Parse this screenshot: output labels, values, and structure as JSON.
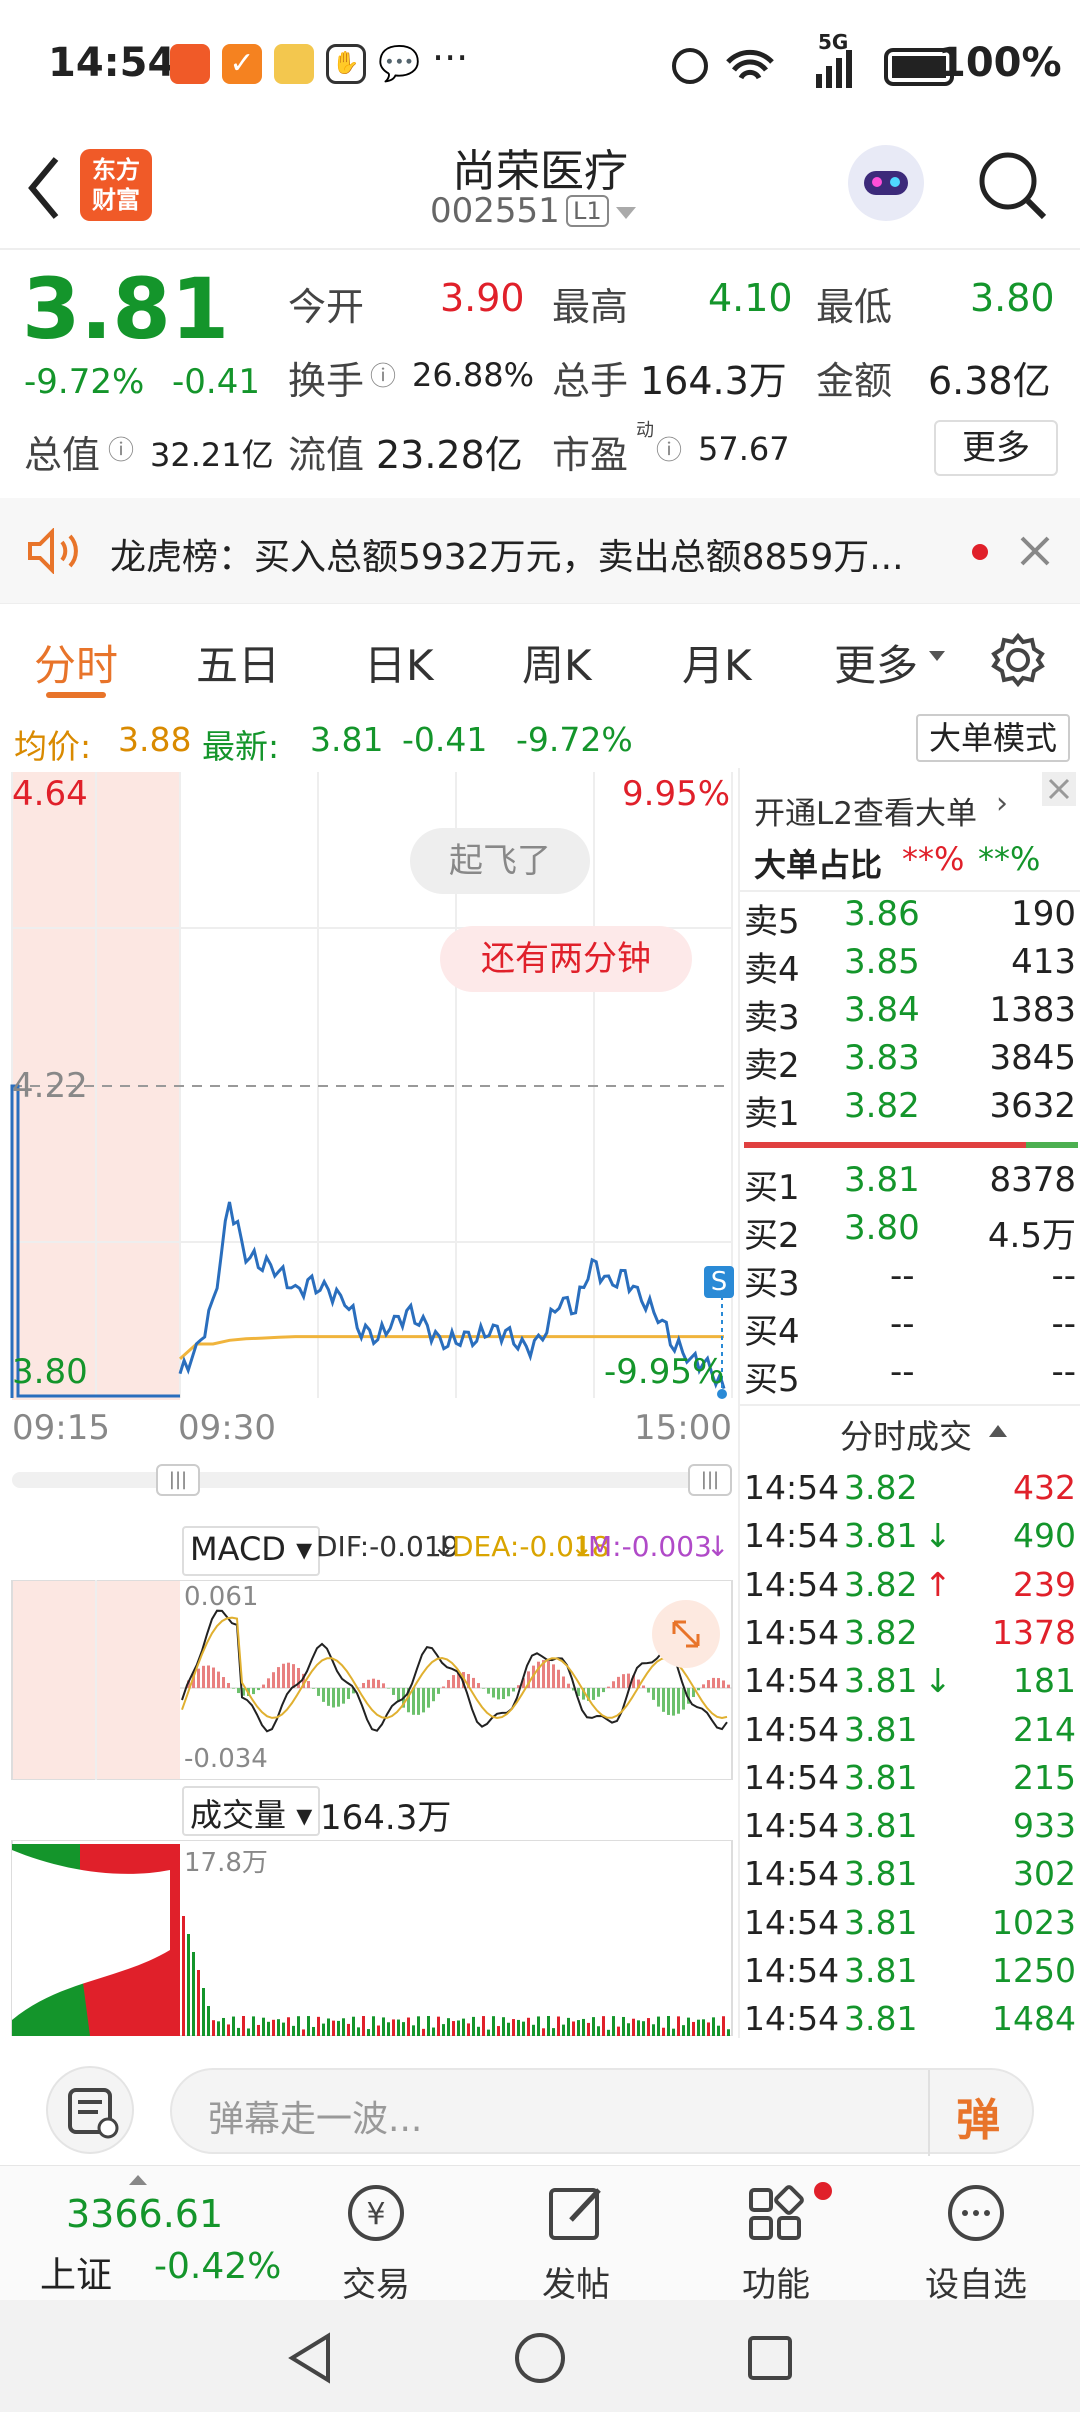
{
  "status": {
    "time": "14:54",
    "battery": "100%",
    "network": "5G"
  },
  "header": {
    "title": "尚荣医疗",
    "code": "002551",
    "level": "L1",
    "logo": "东方\n财富"
  },
  "quote": {
    "price": "3.81",
    "pct": "-9.72%",
    "chg": "-0.41",
    "open_label": "今开",
    "open": "3.90",
    "high_label": "最高",
    "high": "4.10",
    "low_label": "最低",
    "low": "3.80",
    "turnover_label": "换手",
    "turnover": "26.88%",
    "volume_label": "总手",
    "volume": "164.3万",
    "amount_label": "金额",
    "amount": "6.38亿",
    "mktcap_label": "总值",
    "mktcap": "32.21亿",
    "float_label": "流值",
    "float": "23.28亿",
    "pe_label": "市盈",
    "pe_sup": "动",
    "pe": "57.67",
    "more": "更多"
  },
  "notice": {
    "text": "龙虎榜：买入总额5932万元，卖出总额8859万..."
  },
  "tabs": [
    "分时",
    "五日",
    "日K",
    "周K",
    "月K",
    "更多"
  ],
  "infobar": {
    "avg_label": "均价:",
    "avg": "3.88",
    "latest_label": "最新:",
    "latest": "3.81",
    "chg": "-0.41",
    "pct": "-9.72%",
    "mode_btn": "大单模式"
  },
  "chart": {
    "top_price": "4.64",
    "top_pct": "9.95%",
    "mid_price": "4.22",
    "bottom_price": "3.80",
    "bottom_pct": "-9.95%",
    "t_start": "09:15",
    "t_mid": "09:30",
    "t_end": "15:00",
    "bubble1": "起飞了",
    "bubble2": "还有两分钟",
    "s_marker": "S",
    "macd_label": "MACD",
    "dif": "DIF:-0.019",
    "dea": "DEA:-0.018",
    "m": "M:-0.003",
    "macd_top": "0.061",
    "macd_bottom": "-0.034",
    "vol_label": "成交量",
    "vol_value": "164.3万",
    "vol_max": "17.8万"
  },
  "chart_data": {
    "type": "line",
    "series": [
      {
        "values": [
          3.83,
          3.86,
          3.92,
          4.06,
          3.99,
          3.98,
          3.97,
          3.94,
          3.95,
          3.94,
          3.93,
          3.89,
          3.88,
          3.9,
          3.91,
          3.89,
          3.87,
          3.88,
          3.88,
          3.89,
          3.88,
          3.86,
          3.88,
          3.93,
          3.92,
          3.98,
          3.95,
          3.96,
          3.93,
          3.91,
          3.87,
          3.85,
          3.84,
          3.81
        ]
      },
      {
        "values": [
          3.85,
          3.87,
          3.87,
          3.875,
          3.877,
          3.878,
          3.879,
          3.88,
          3.88,
          3.88,
          3.88,
          3.88,
          3.88,
          3.88,
          3.88,
          3.88,
          3.88,
          3.88,
          3.88,
          3.88,
          3.88,
          3.88,
          3.88,
          3.88,
          3.88,
          3.88,
          3.88,
          3.88,
          3.88,
          3.88,
          3.88,
          3.88,
          3.88,
          3.88
        ]
      }
    ],
    "ylim": [
      3.8,
      4.64
    ]
  },
  "book": {
    "l2_text": "开通L2查看大单",
    "big_label": "大单占比",
    "big_red": "**%",
    "big_green": "**%",
    "asks": [
      {
        "label": "卖5",
        "price": "3.86",
        "vol": "190"
      },
      {
        "label": "卖4",
        "price": "3.85",
        "vol": "413"
      },
      {
        "label": "卖3",
        "price": "3.84",
        "vol": "1383"
      },
      {
        "label": "卖2",
        "price": "3.83",
        "vol": "3845"
      },
      {
        "label": "卖1",
        "price": "3.82",
        "vol": "3632"
      }
    ],
    "bids": [
      {
        "label": "买1",
        "price": "3.81",
        "vol": "8378"
      },
      {
        "label": "买2",
        "price": "3.80",
        "vol": "4.5万"
      },
      {
        "label": "买3",
        "price": "--",
        "vol": "--"
      },
      {
        "label": "买4",
        "price": "--",
        "vol": "--"
      },
      {
        "label": "买5",
        "price": "--",
        "vol": "--"
      }
    ],
    "trades_title": "分时成交",
    "trades": [
      {
        "t": "14:54",
        "p": "3.82",
        "a": "",
        "v": "432",
        "vc": "red"
      },
      {
        "t": "14:54",
        "p": "3.81",
        "a": "↓",
        "v": "490",
        "vc": "green"
      },
      {
        "t": "14:54",
        "p": "3.82",
        "a": "↑",
        "v": "239",
        "vc": "red"
      },
      {
        "t": "14:54",
        "p": "3.82",
        "a": "",
        "v": "1378",
        "vc": "red"
      },
      {
        "t": "14:54",
        "p": "3.81",
        "a": "↓",
        "v": "181",
        "vc": "green"
      },
      {
        "t": "14:54",
        "p": "3.81",
        "a": "",
        "v": "214",
        "vc": "green"
      },
      {
        "t": "14:54",
        "p": "3.81",
        "a": "",
        "v": "215",
        "vc": "green"
      },
      {
        "t": "14:54",
        "p": "3.81",
        "a": "",
        "v": "933",
        "vc": "green"
      },
      {
        "t": "14:54",
        "p": "3.81",
        "a": "",
        "v": "302",
        "vc": "green"
      },
      {
        "t": "14:54",
        "p": "3.81",
        "a": "",
        "v": "1023",
        "vc": "green"
      },
      {
        "t": "14:54",
        "p": "3.81",
        "a": "",
        "v": "1250",
        "vc": "green"
      },
      {
        "t": "14:54",
        "p": "3.81",
        "a": "",
        "v": "1484",
        "vc": "green"
      }
    ]
  },
  "danmu": {
    "placeholder": "弹幕走一波...",
    "send": "弹"
  },
  "bottomnav": {
    "index_value": "3366.61",
    "index_name": "上证",
    "index_pct": "-0.42%",
    "items": [
      "交易",
      "发帖",
      "功能",
      "设自选"
    ]
  }
}
